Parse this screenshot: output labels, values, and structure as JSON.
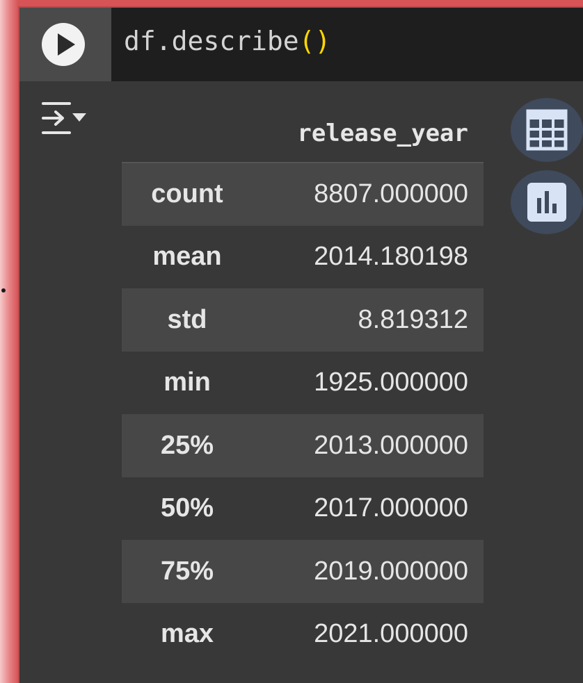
{
  "cell": {
    "code": {
      "object": "df",
      "method": ".describe",
      "parens": "()"
    }
  },
  "output": {
    "table": {
      "column_header": "release_year",
      "rows": [
        {
          "label": "count",
          "value": "8807.000000"
        },
        {
          "label": "mean",
          "value": "2014.180198"
        },
        {
          "label": "std",
          "value": "8.819312"
        },
        {
          "label": "min",
          "value": "1925.000000"
        },
        {
          "label": "25%",
          "value": "2013.000000"
        },
        {
          "label": "50%",
          "value": "2017.000000"
        },
        {
          "label": "75%",
          "value": "2019.000000"
        },
        {
          "label": "max",
          "value": "2021.000000"
        }
      ]
    },
    "icons": {
      "run": "play-icon",
      "output_toggle": "output-toggle-icon",
      "table_view": "table-icon",
      "chart_suggest": "bar-chart-icon"
    }
  },
  "colors": {
    "cell_background": "#383838",
    "code_background": "#1e1e1e",
    "gutter_background": "#4a4a4a",
    "paren_color": "#ffd700",
    "stripe": "#474747",
    "button_background": "#3f4a5c",
    "icon_light": "#d8e4f5"
  }
}
